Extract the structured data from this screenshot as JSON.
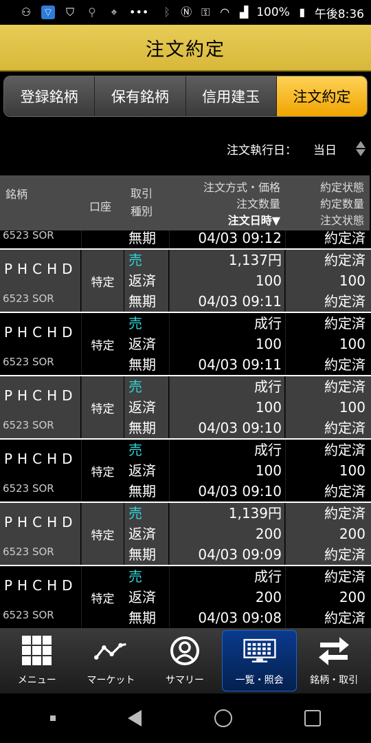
{
  "status_bar": {
    "battery": "100%",
    "time": "午後8:36"
  },
  "title": "注文約定",
  "tabs": [
    {
      "label": "登録銘柄",
      "active": false
    },
    {
      "label": "保有銘柄",
      "active": false
    },
    {
      "label": "信用建玉",
      "active": false
    },
    {
      "label": "注文約定",
      "active": true
    }
  ],
  "filter": {
    "label": "注文執行日：",
    "value": "当日"
  },
  "table_header": {
    "meigara": "銘柄",
    "kouza": "口座",
    "torihiki1": "取引",
    "torihiki2": "種別",
    "order1": "注文方式・価格",
    "order2": "注文数量",
    "order3": "注文日時▼",
    "yakujo1": "約定状態",
    "yakujo2": "約定数量",
    "yakujo3": "注文状態"
  },
  "partial_row": {
    "code": "6523 SOR",
    "type3": "無期",
    "datetime": "04/03 09:12",
    "status3": "約定済"
  },
  "rows": [
    {
      "symbol": "PHCHD",
      "code": "6523 SOR",
      "account": "特定",
      "side": "売",
      "type2": "返済",
      "type3": "無期",
      "price": "1,137円",
      "qty": "100",
      "datetime": "04/03 09:11",
      "exec_status": "約定済",
      "exec_qty": "100",
      "order_status": "約定済"
    },
    {
      "symbol": "PHCHD",
      "code": "6523 SOR",
      "account": "特定",
      "side": "売",
      "type2": "返済",
      "type3": "無期",
      "price": "成行",
      "qty": "100",
      "datetime": "04/03 09:11",
      "exec_status": "約定済",
      "exec_qty": "100",
      "order_status": "約定済"
    },
    {
      "symbol": "PHCHD",
      "code": "6523 SOR",
      "account": "特定",
      "side": "売",
      "type2": "返済",
      "type3": "無期",
      "price": "成行",
      "qty": "100",
      "datetime": "04/03 09:10",
      "exec_status": "約定済",
      "exec_qty": "100",
      "order_status": "約定済"
    },
    {
      "symbol": "PHCHD",
      "code": "6523 SOR",
      "account": "特定",
      "side": "売",
      "type2": "返済",
      "type3": "無期",
      "price": "成行",
      "qty": "100",
      "datetime": "04/03 09:10",
      "exec_status": "約定済",
      "exec_qty": "100",
      "order_status": "約定済"
    },
    {
      "symbol": "PHCHD",
      "code": "6523 SOR",
      "account": "特定",
      "side": "売",
      "type2": "返済",
      "type3": "無期",
      "price": "1,139円",
      "qty": "200",
      "datetime": "04/03 09:09",
      "exec_status": "約定済",
      "exec_qty": "200",
      "order_status": "約定済"
    },
    {
      "symbol": "PHCHD",
      "code": "6523 SOR",
      "account": "特定",
      "side": "売",
      "type2": "返済",
      "type3": "無期",
      "price": "成行",
      "qty": "200",
      "datetime": "04/03 09:08",
      "exec_status": "約定済",
      "exec_qty": "200",
      "order_status": "約定済"
    }
  ],
  "bottom_nav": [
    {
      "label": "メニュー",
      "icon": "grid-icon",
      "active": false
    },
    {
      "label": "マーケット",
      "icon": "chart-line-icon",
      "active": false
    },
    {
      "label": "サマリー",
      "icon": "user-icon",
      "active": false
    },
    {
      "label": "一覧・照会",
      "icon": "monitor-icon",
      "active": true
    },
    {
      "label": "銘柄・取引",
      "icon": "swap-icon",
      "active": false
    }
  ],
  "colors": {
    "title_bar": "#e0c24a",
    "active_tab": "#f5b21a",
    "sell": "#2fd3d8",
    "active_nav": "#0a3a8c"
  }
}
